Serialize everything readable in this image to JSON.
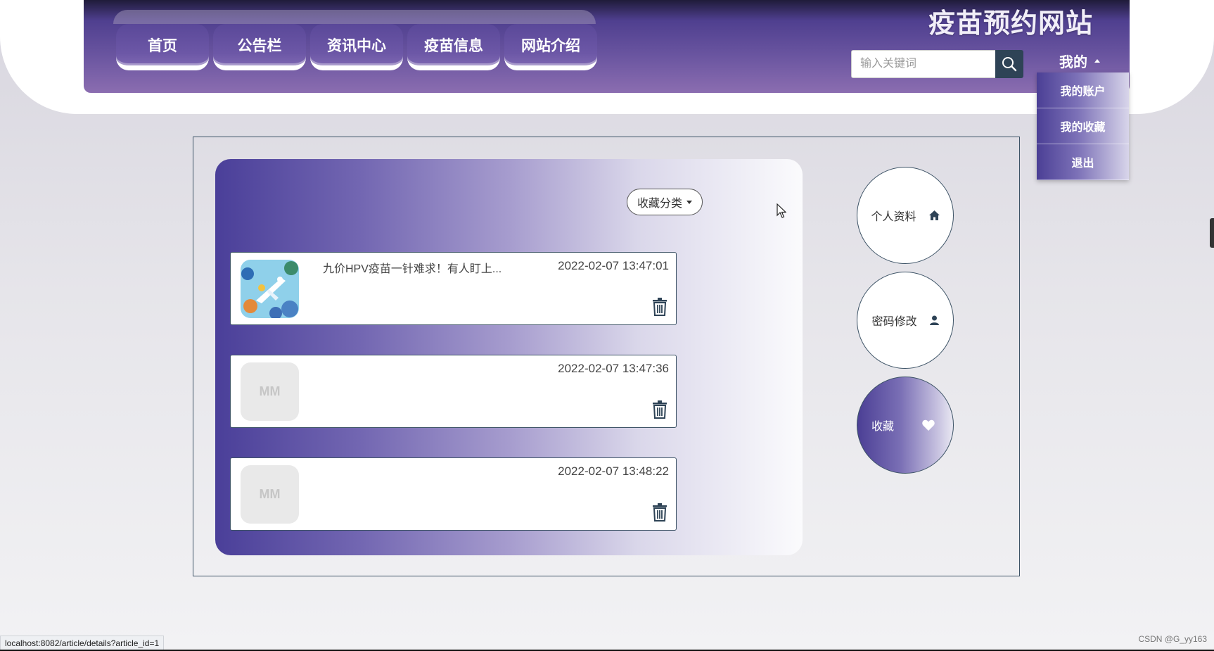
{
  "nav": {
    "items": [
      {
        "label": "首页"
      },
      {
        "label": "公告栏"
      },
      {
        "label": "资讯中心"
      },
      {
        "label": "疫苗信息"
      },
      {
        "label": "网站介绍"
      }
    ]
  },
  "header": {
    "site_title": "疫苗预约网站",
    "search": {
      "placeholder": "输入关键词",
      "value": "",
      "icon": "search-icon"
    }
  },
  "user_menu": {
    "label": "我的",
    "items": [
      {
        "label": "我的账户"
      },
      {
        "label": "我的收藏"
      },
      {
        "label": "退出"
      }
    ]
  },
  "favorites": {
    "category_button": "收藏分类",
    "cards": [
      {
        "title": "九价HPV疫苗一针难求！有人盯上...",
        "time": "2022-02-07 13:47:01",
        "thumb": "image"
      },
      {
        "title": "",
        "time": "2022-02-07 13:47:36",
        "thumb": "MM"
      },
      {
        "title": "",
        "time": "2022-02-07 13:48:22",
        "thumb": "MM"
      }
    ]
  },
  "side_menu": {
    "items": [
      {
        "label": "个人资料",
        "icon": "home-icon"
      },
      {
        "label": "密码修改",
        "icon": "user-icon"
      },
      {
        "label": "收藏",
        "icon": "heart-icon"
      }
    ]
  },
  "status_bar": {
    "url": "localhost:8082/article/details?article_id=1"
  },
  "watermark": "CSDN @G_yy163",
  "colors": {
    "header_purple": "#6a55a0",
    "panel_gradient_start": "#4a3f99",
    "border_dark": "#3d5366",
    "search_button": "#2e4356"
  }
}
